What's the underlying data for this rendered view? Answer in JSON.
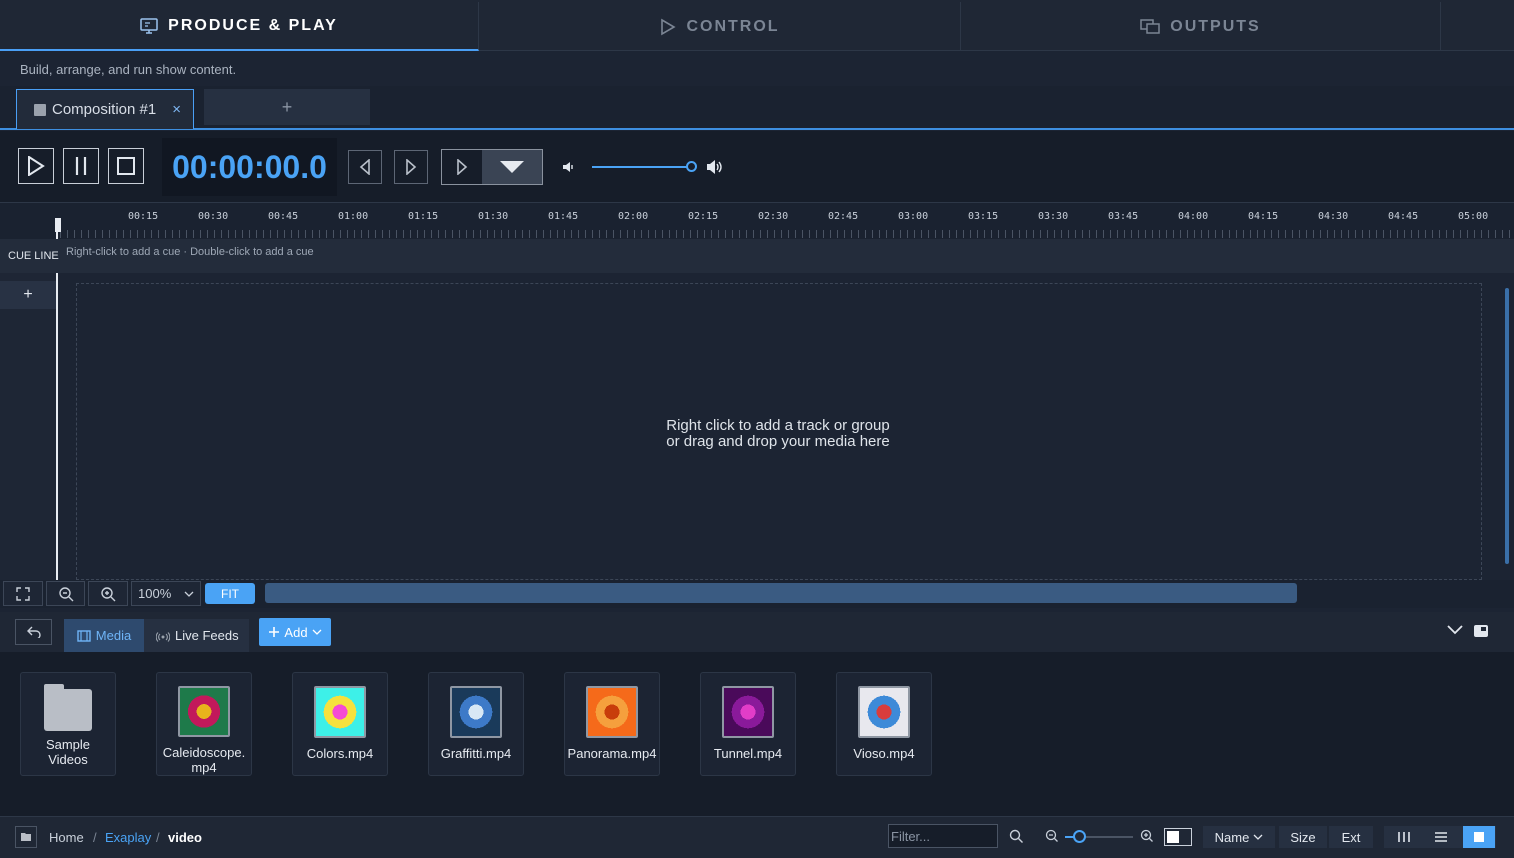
{
  "top_tabs": [
    {
      "label": "PRODUCE & PLAY",
      "icon": "monitor-icon",
      "active": true
    },
    {
      "label": "CONTROL",
      "icon": "play-outline-icon",
      "active": false
    },
    {
      "label": "OUTPUTS",
      "icon": "outputs-icon",
      "active": false
    }
  ],
  "subtitle": "Build, arrange, and run show content.",
  "composition_tab": {
    "label": "Composition #1",
    "close": "×"
  },
  "add_tab_label": "+",
  "transport": {
    "timecode": "00:00:00.0"
  },
  "ruler_ticks": [
    "00:15",
    "00:30",
    "00:45",
    "01:00",
    "01:15",
    "01:30",
    "01:45",
    "02:00",
    "02:15",
    "02:30",
    "02:45",
    "03:00",
    "03:15",
    "03:30",
    "03:45",
    "04:00",
    "04:15",
    "04:30",
    "04:45",
    "05:00"
  ],
  "cue_line": {
    "label": "CUE LINE",
    "hint": "Right-click to add a cue · Double-click to add a cue"
  },
  "track_add": "+",
  "drop_message": {
    "line1": "Right click to add a track or group",
    "line2": "or drag and drop your media here"
  },
  "zoom": {
    "value": "100%",
    "fit_label": "FIT"
  },
  "media_panel": {
    "tabs": [
      {
        "label": "Media",
        "icon": "film-icon",
        "active": true
      },
      {
        "label": "Live Feeds",
        "icon": "broadcast-icon",
        "active": false
      }
    ],
    "add_label": "Add",
    "items": [
      {
        "label": "Sample Videos",
        "type": "folder"
      },
      {
        "label": "Caleidoscope.mp4",
        "type": "video",
        "colors": [
          "#1e7a4a",
          "#e8b31c",
          "#c2185b"
        ]
      },
      {
        "label": "Colors.mp4",
        "type": "video",
        "colors": [
          "#3df0e8",
          "#f54ad3",
          "#f5e13d"
        ]
      },
      {
        "label": "Graffitti.mp4",
        "type": "video",
        "colors": [
          "#1a3a5a",
          "#d8e8f5",
          "#3d7ac8"
        ]
      },
      {
        "label": "Panorama.mp4",
        "type": "video",
        "colors": [
          "#f56a1a",
          "#c83d0a",
          "#f5a03d"
        ]
      },
      {
        "label": "Tunnel.mp4",
        "type": "video",
        "colors": [
          "#4a0a5a",
          "#e23dc8",
          "#8a1a9a"
        ]
      },
      {
        "label": "Vioso.mp4",
        "type": "video",
        "colors": [
          "#e8e8ee",
          "#d83d3d",
          "#3d8ad8"
        ]
      }
    ]
  },
  "breadcrumb": {
    "home": "Home",
    "mid": "Exaplay",
    "current": "video",
    "sep": "/"
  },
  "filter_placeholder": "Filter...",
  "sort": {
    "name": "Name",
    "size": "Size",
    "ext": "Ext"
  }
}
